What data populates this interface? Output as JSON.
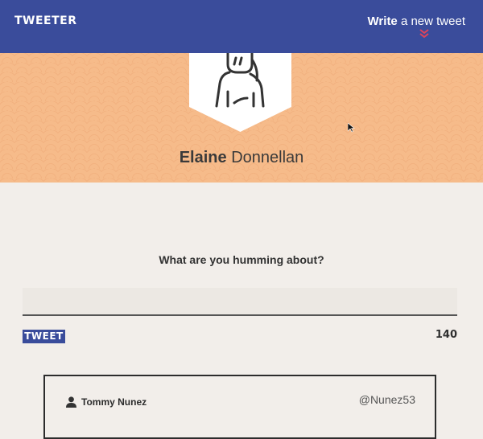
{
  "nav": {
    "brand": "TWEETER",
    "compose_bold": "Write",
    "compose_rest": " a new tweet",
    "compose_icon": "double-chevron-down-icon"
  },
  "profile": {
    "first_name": "Elaine",
    "last_name": " Donnellan",
    "avatar_icon": "user-avatar-icon"
  },
  "composer": {
    "prompt": "What are you humming about?",
    "placeholder": "",
    "submit_label": "TWEET",
    "char_count": "140"
  },
  "tweets": [
    {
      "author": "Tommy Nunez",
      "handle": "@Nunez53",
      "author_icon": "user-icon"
    }
  ],
  "colors": {
    "nav": "#3a4c9b",
    "banner": "#f6bb8a",
    "background": "#f2eeea",
    "chevron": "#e0445a"
  }
}
